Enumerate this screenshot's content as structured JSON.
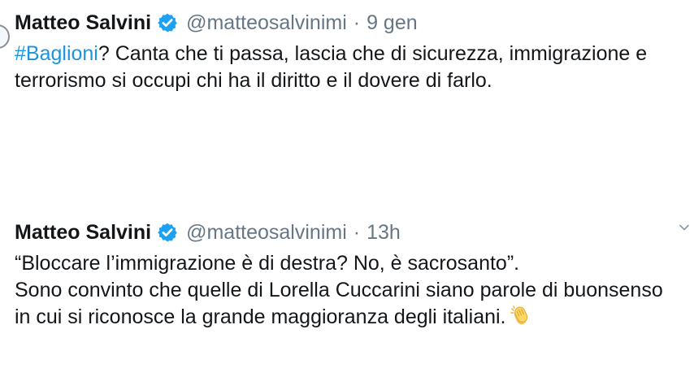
{
  "colors": {
    "text": "#14171a",
    "secondary": "#657786",
    "link": "#1b95e0",
    "verified": "#1da1f2"
  },
  "tweets": [
    {
      "author": "Matteo Salvini",
      "handle": "@matteosalvinimi",
      "separator": "·",
      "time": "9 gen",
      "verified_icon": "verified-badge-icon",
      "hashtag": "#Baglioni",
      "text_after_hashtag": "? Canta che ti passa, lascia che di sicurezza, immigrazione e",
      "text_line_2": "terrorismo si occupi chi ha il diritto e il dovere di farlo."
    },
    {
      "author": "Matteo Salvini",
      "handle": "@matteosalvinimi",
      "separator": "·",
      "time": "13h",
      "verified_icon": "verified-badge-icon",
      "lines": [
        "“Bloccare l’immigrazione è di destra? No, è sacrosanto”.",
        "Sono convinto che quelle di Lorella Cuccarini siano parole di buonsenso",
        "in cui si riconosce la grande maggioranza degli italiani."
      ],
      "emoji_icon": "clapping-hands-icon",
      "menu_icon": "chevron-down-icon"
    }
  ]
}
